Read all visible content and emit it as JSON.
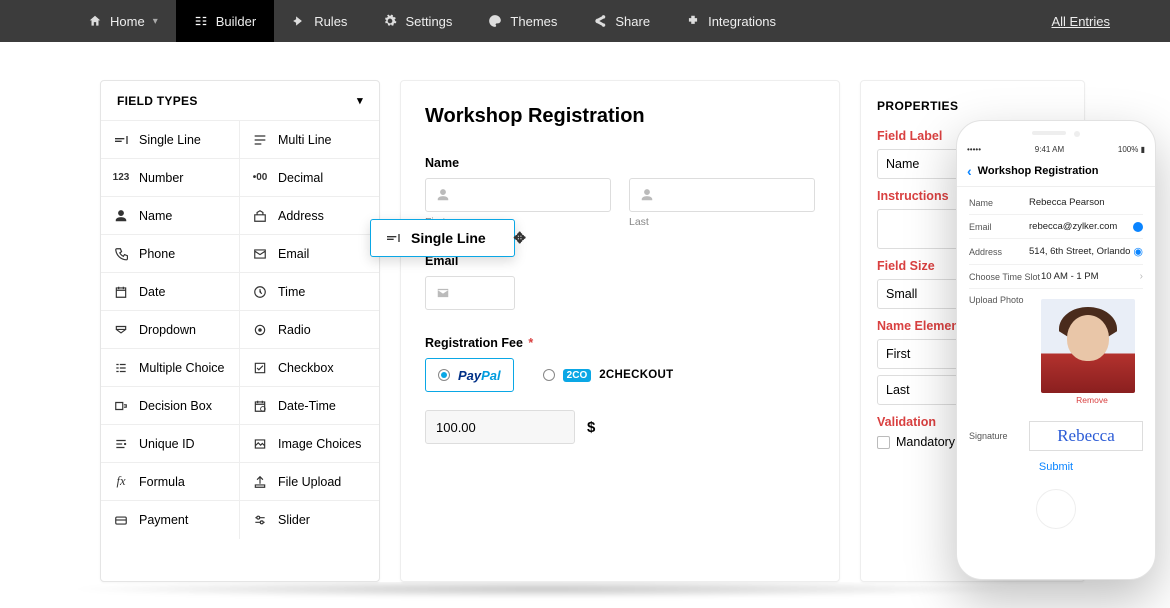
{
  "nav": {
    "home": "Home",
    "builder": "Builder",
    "rules": "Rules",
    "settings": "Settings",
    "themes": "Themes",
    "share": "Share",
    "integrations": "Integrations",
    "all_entries": "All Entries"
  },
  "fieldtypes": {
    "header": "FIELD TYPES",
    "items": [
      {
        "l": "Single Line"
      },
      {
        "l": "Multi Line"
      },
      {
        "l": "Number"
      },
      {
        "l": "Decimal"
      },
      {
        "l": "Name"
      },
      {
        "l": "Address"
      },
      {
        "l": "Phone"
      },
      {
        "l": "Email"
      },
      {
        "l": "Date"
      },
      {
        "l": "Time"
      },
      {
        "l": "Dropdown"
      },
      {
        "l": "Radio"
      },
      {
        "l": "Multiple Choice"
      },
      {
        "l": "Checkbox"
      },
      {
        "l": "Decision Box"
      },
      {
        "l": "Date-Time"
      },
      {
        "l": "Unique ID"
      },
      {
        "l": "Image Choices"
      },
      {
        "l": "Formula"
      },
      {
        "l": "File Upload"
      },
      {
        "l": "Payment"
      },
      {
        "l": "Slider"
      }
    ]
  },
  "drag": {
    "label": "Single Line"
  },
  "form": {
    "title": "Workshop Registration",
    "name_label": "Name",
    "first_cap": "First",
    "last_cap": "Last",
    "email_label": "Email",
    "fee_label": "Registration Fee",
    "paypal": "PayPal",
    "twoco_badge": "2CO",
    "twocheckout": "2CHECKOUT",
    "fee_value": "100.00",
    "currency": "$"
  },
  "props": {
    "header": "PROPERTIES",
    "field_label_label": "Field Label",
    "field_label_value": "Name",
    "instructions_label": "Instructions",
    "field_size_label": "Field  Size",
    "field_size_value": "Small",
    "name_elems_label": "Name Elements",
    "first": "First",
    "last": "Last",
    "validation_label": "Validation",
    "mandatory": "Mandatory"
  },
  "phone": {
    "status_left": "•••••",
    "status_time": "9:41 AM",
    "status_right": "100% ▮",
    "header": "Workshop Registration",
    "rows": {
      "name_l": "Name",
      "name_v": "Rebecca Pearson",
      "email_l": "Email",
      "email_v": "rebecca@zylker.com",
      "addr_l": "Address",
      "addr_v": "514, 6th Street, Orlando",
      "slot_l": "Choose Time Slot",
      "slot_v": "10 AM - 1 PM",
      "photo_l": "Upload Photo",
      "remove": "Remove",
      "sig_l": "Signature",
      "sig_v": "Rebecca"
    },
    "submit": "Submit"
  }
}
